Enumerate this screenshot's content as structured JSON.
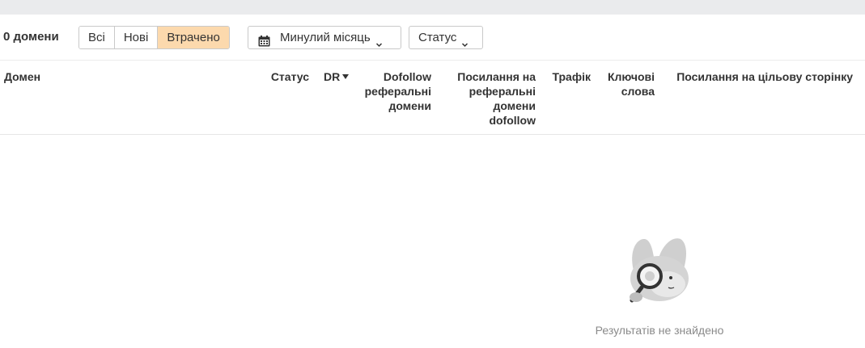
{
  "summary": {
    "count_label": "0 домени"
  },
  "filters": {
    "segments": [
      {
        "label": "Всі",
        "active": false
      },
      {
        "label": "Нові",
        "active": false
      },
      {
        "label": "Втрачено",
        "active": true
      }
    ],
    "date_dropdown": {
      "label": "Минулий місяць",
      "icon": "calendar-icon"
    },
    "status_dropdown": {
      "label": "Статус"
    }
  },
  "table": {
    "columns": {
      "domain": "Домен",
      "status": "Статус",
      "dr": "DR",
      "dofollow_ref_domains": [
        "Dofollow",
        "реферальні",
        "домени"
      ],
      "links_to_ref_domains": [
        "Посилання на",
        "реферальні",
        "домени",
        "dofollow"
      ],
      "traffic": "Трафік",
      "keywords": [
        "Ключові",
        "слова"
      ],
      "target_links": "Посилання на цільову сторінку"
    },
    "sort": {
      "column": "DR",
      "direction": "desc"
    }
  },
  "empty_state": {
    "message": "Результатів не знайдено",
    "illustration": "mascot-magnifier-icon"
  },
  "colors": {
    "active_segment": "#fcd9ad",
    "top_strip": "#eaebed"
  }
}
